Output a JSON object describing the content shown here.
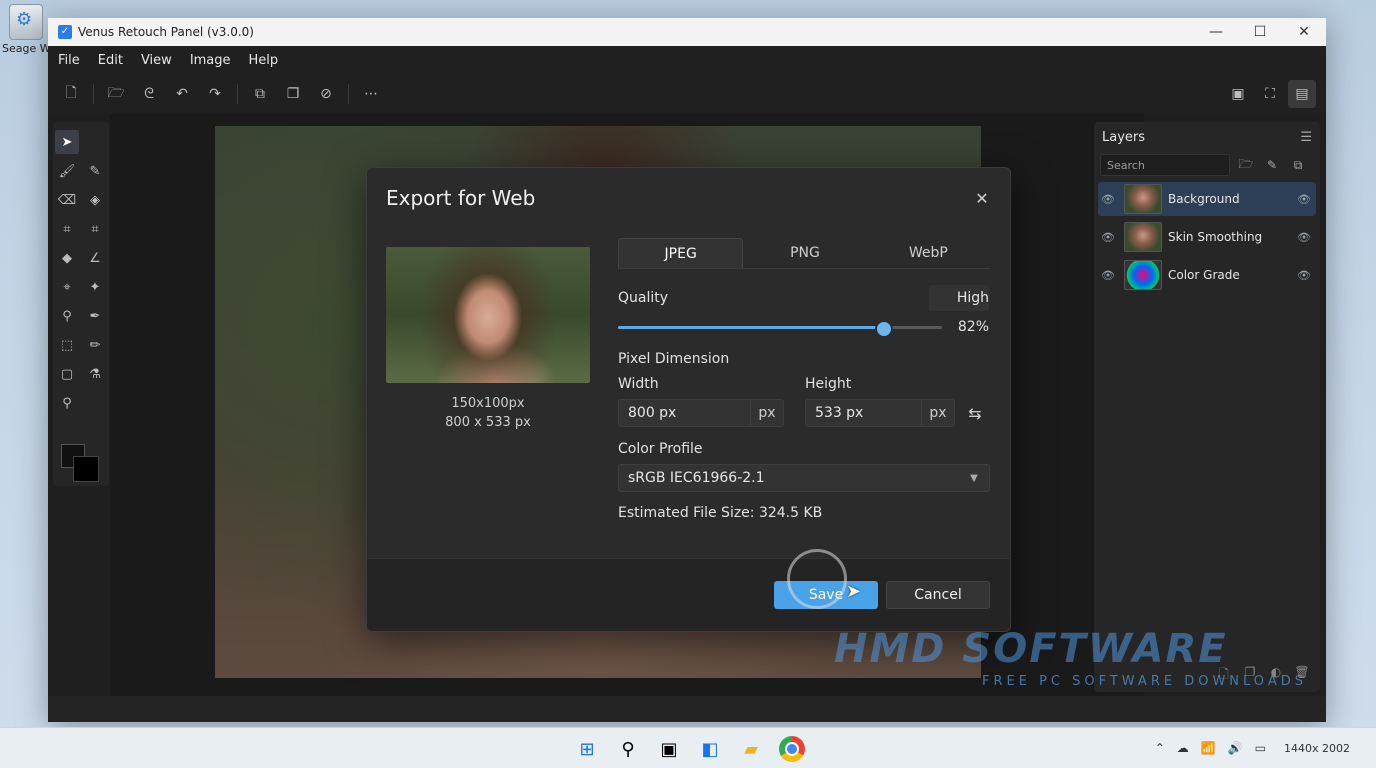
{
  "desktop": {
    "icon_label": "Seage W"
  },
  "window": {
    "title": "Venus Retouch Panel (v3.0.0)"
  },
  "menu": [
    "File",
    "Edit",
    "View",
    "Image",
    "Help"
  ],
  "layers": {
    "title": "Layers",
    "search_placeholder": "Search",
    "items": [
      {
        "name": "Background"
      },
      {
        "name": "Skin Smoothing"
      },
      {
        "name": "Color Grade"
      }
    ]
  },
  "dialog": {
    "title": "Export for Web",
    "preview_size": "150x100px",
    "preview_dims": "800 x 533 px",
    "tabs": [
      "JPEG",
      "PNG",
      "WebP"
    ],
    "active_tab": "JPEG",
    "quality_label": "Quality",
    "quality_preset": "High",
    "quality_value": "82%",
    "quality_fraction": 0.82,
    "pixel_dimension_label": "Pixel Dimension",
    "width_label": "Width",
    "width_value": "800 px",
    "width_unit": "px",
    "height_label": "Height",
    "height_value": "533 px",
    "height_unit": "px",
    "color_profile_label": "Color Profile",
    "color_profile_value": "sRGB IEC61966-2.1",
    "file_size": "Estimated File Size: 324.5 KB",
    "save_label": "Save",
    "cancel_label": "Cancel"
  },
  "watermark": {
    "main": "HMD SOFTWARE",
    "sub": "FREE PC SOFTWARE DOWNLOADS"
  },
  "taskbar": {
    "clock": "1440x 2002"
  }
}
